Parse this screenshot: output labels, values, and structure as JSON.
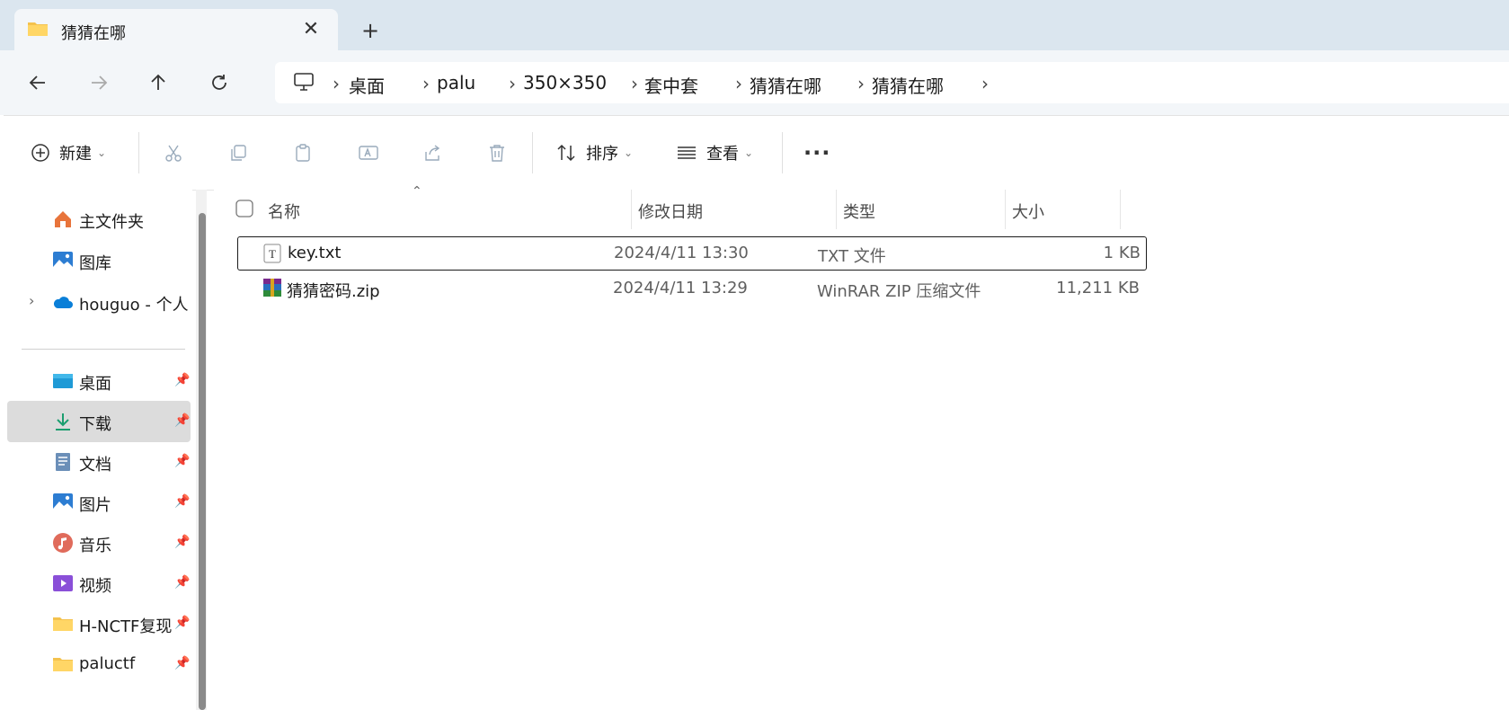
{
  "window": {
    "tab_title": "猜猜在哪",
    "close_glyph": "✕",
    "new_tab_glyph": "+"
  },
  "breadcrumb": [
    "桌面",
    "palu",
    "350×350",
    "套中套",
    "猜猜在哪",
    "猜猜在哪"
  ],
  "toolbar": {
    "new_label": "新建",
    "sort_label": "排序",
    "view_label": "查看",
    "more_glyph": "···"
  },
  "sidebar": {
    "top_items": [
      {
        "label": "主文件夹",
        "icon": "home-icon"
      },
      {
        "label": "图库",
        "icon": "gallery-icon"
      },
      {
        "label": "houguo - 个人",
        "icon": "onedrive-cloud-icon"
      }
    ],
    "pinned_items": [
      {
        "label": "桌面",
        "icon": "desktop-icon"
      },
      {
        "label": "下载",
        "icon": "download-icon",
        "selected": true
      },
      {
        "label": "文档",
        "icon": "document-icon"
      },
      {
        "label": "图片",
        "icon": "pictures-icon"
      },
      {
        "label": "音乐",
        "icon": "music-icon"
      },
      {
        "label": "视频",
        "icon": "video-icon"
      },
      {
        "label": "H-NCTF复现",
        "icon": "folder-icon"
      },
      {
        "label": "paluctf",
        "icon": "folder-icon"
      }
    ]
  },
  "columns": {
    "name": "名称",
    "date": "修改日期",
    "type": "类型",
    "size": "大小"
  },
  "files": [
    {
      "name": "key.txt",
      "date": "2024/4/11 13:30",
      "type": "TXT 文件",
      "size": "1 KB",
      "icon": "text-file-icon"
    },
    {
      "name": "猜猜密码.zip",
      "date": "2024/4/11 13:29",
      "type": "WinRAR ZIP 压缩文件",
      "size": "11,211 KB",
      "icon": "winrar-archive-icon"
    }
  ],
  "colors": {
    "titlebar_bg": "#dbe6ef",
    "navbar_bg": "#f3f6f9",
    "selected_bg": "#dcdcdc",
    "accent": "#0067c0"
  }
}
